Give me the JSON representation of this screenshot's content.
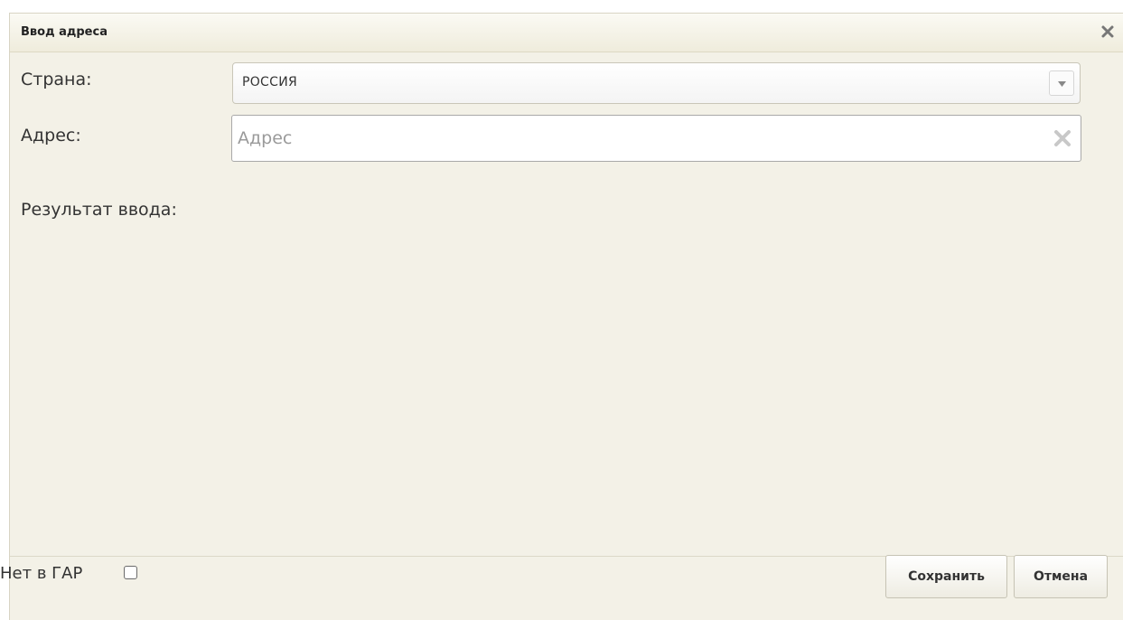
{
  "dialog": {
    "title": "Ввод адреса",
    "close_icon": "close-icon"
  },
  "country": {
    "label": "Страна:",
    "value": "РОССИЯ",
    "dropdown_icon": "chevron-down-icon"
  },
  "address": {
    "label": "Адрес:",
    "value": "",
    "placeholder": "Адрес",
    "clear_icon": "clear-icon"
  },
  "result": {
    "label": "Результат ввода:"
  },
  "footer": {
    "not_in_gar_label": "Нет в ГАР",
    "not_in_gar_checked": false,
    "save_label": "Сохранить",
    "cancel_label": "Отмена"
  },
  "colors": {
    "dialog_bg": "#f3f1e7",
    "titlebar_bg": "#efecdc",
    "text": "#333333"
  }
}
